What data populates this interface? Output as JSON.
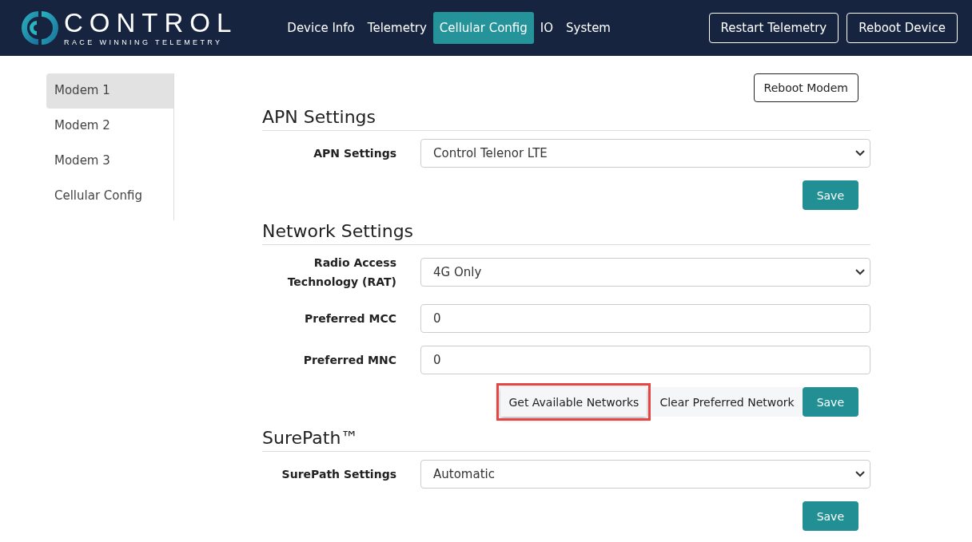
{
  "brand": {
    "name": "CONTROL",
    "tagline": "RACE WINNING TELEMETRY"
  },
  "nav": [
    {
      "label": "Device Info",
      "selected": false
    },
    {
      "label": "Telemetry",
      "selected": false
    },
    {
      "label": "Cellular Config",
      "selected": true
    },
    {
      "label": "IO",
      "selected": false
    },
    {
      "label": "System",
      "selected": false
    }
  ],
  "header_buttons": [
    "Restart Telemetry",
    "Reboot Device"
  ],
  "sidebar": {
    "items": [
      {
        "label": "Modem 1",
        "selected": true
      },
      {
        "label": "Modem 2",
        "selected": false
      },
      {
        "label": "Modem 3",
        "selected": false
      },
      {
        "label": "Cellular Config",
        "selected": false
      }
    ]
  },
  "reboot_modem": "Reboot Modem",
  "sections": [
    {
      "title": "APN Settings",
      "fields": [
        {
          "kind": "select",
          "label": "APN Settings",
          "value": "Control Telenor LTE"
        }
      ],
      "buttons": [
        {
          "kind": "primary",
          "label": "Save",
          "highlighted": false
        }
      ]
    },
    {
      "title": "Network Settings",
      "fields": [
        {
          "kind": "select",
          "label": "Radio Access Technology (RAT)",
          "value": "4G Only"
        },
        {
          "kind": "input",
          "label": "Preferred MCC",
          "value": "0"
        },
        {
          "kind": "input",
          "label": "Preferred MNC",
          "value": "0"
        }
      ],
      "buttons": [
        {
          "kind": "light",
          "label": "Get Available Networks",
          "highlighted": true
        },
        {
          "kind": "light",
          "label": "Clear Preferred Network",
          "highlighted": false
        },
        {
          "kind": "primary",
          "label": "Save",
          "highlighted": false
        }
      ]
    },
    {
      "title": "SurePath™",
      "fields": [
        {
          "kind": "select",
          "label": "SurePath Settings",
          "value": "Automatic"
        }
      ],
      "buttons": [
        {
          "kind": "primary",
          "label": "Save",
          "highlighted": false
        }
      ]
    }
  ]
}
